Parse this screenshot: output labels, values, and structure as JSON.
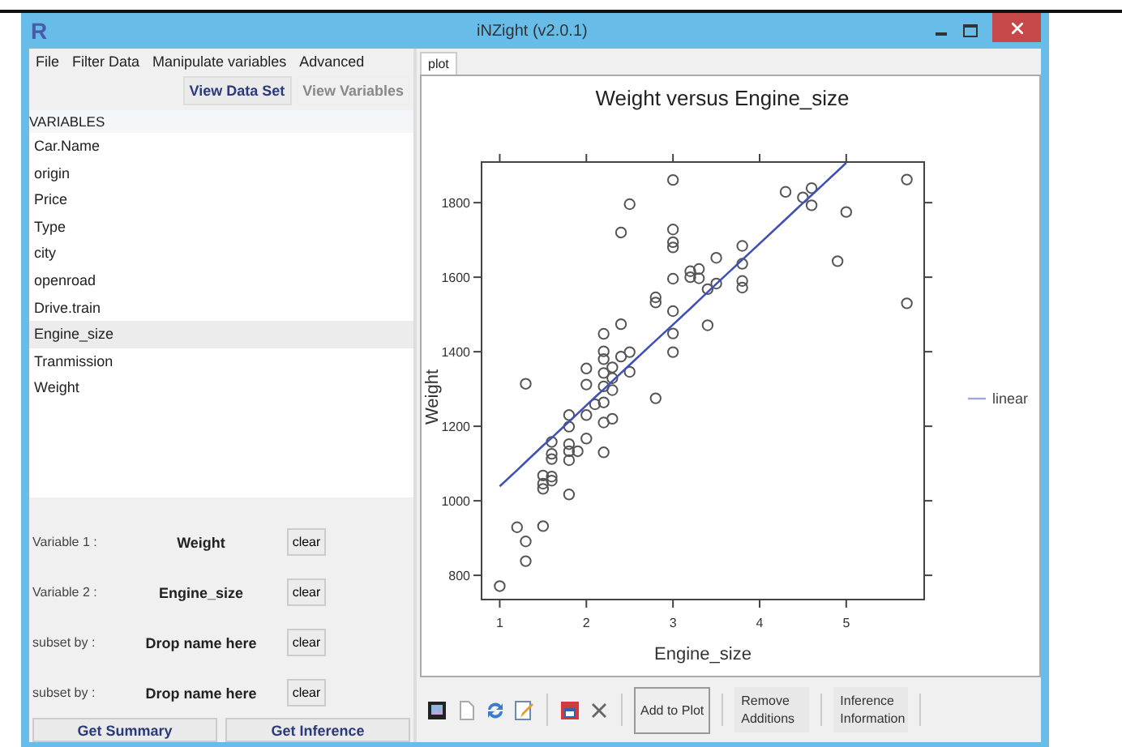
{
  "window": {
    "icon_text": "R",
    "title": "iNZight (v2.0.1)"
  },
  "menu": [
    "File",
    "Filter Data",
    "Manipulate variables",
    "Advanced"
  ],
  "data_buttons": [
    {
      "label": "View Data Set",
      "disabled": false
    },
    {
      "label": "View Variables",
      "disabled": true
    }
  ],
  "variables": {
    "header": "VARIABLES",
    "items": [
      {
        "label": "Car.Name",
        "selected": false
      },
      {
        "label": "origin",
        "selected": false
      },
      {
        "label": "Price",
        "selected": false
      },
      {
        "label": "Type",
        "selected": false
      },
      {
        "label": "city",
        "selected": false
      },
      {
        "label": "openroad",
        "selected": false
      },
      {
        "label": "Drive.train",
        "selected": false
      },
      {
        "label": "Engine_size",
        "selected": true
      },
      {
        "label": "Tranmission",
        "selected": false
      },
      {
        "label": "Weight",
        "selected": false
      }
    ]
  },
  "assignments": [
    {
      "label": "Variable 1 :",
      "value": "Weight",
      "button": "clear"
    },
    {
      "label": "Variable 2 :",
      "value": "Engine_size",
      "button": "clear"
    },
    {
      "label": "subset by :",
      "value": "Drop name here",
      "button": "clear"
    },
    {
      "label": "subset by :",
      "value": "Drop name here",
      "button": "clear"
    }
  ],
  "actions": [
    "Get Summary",
    "Get Inference"
  ],
  "tabs": [
    {
      "label": "plot",
      "selected": true
    }
  ],
  "plot": {
    "chart_data": {
      "type": "scatter",
      "title": "Weight versus Engine_size",
      "xlabel": "Engine_size",
      "ylabel": "Weight",
      "x": [
        1.0,
        1.2,
        1.3,
        1.3,
        1.3,
        1.5,
        1.5,
        1.5,
        1.5,
        1.6,
        1.6,
        1.6,
        1.6,
        1.6,
        1.8,
        1.8,
        1.8,
        1.8,
        1.8,
        1.8,
        1.9,
        2.0,
        2.0,
        2.0,
        2.0,
        2.1,
        2.2,
        2.2,
        2.2,
        2.2,
        2.2,
        2.2,
        2.2,
        2.2,
        2.3,
        2.3,
        2.3,
        2.3,
        2.4,
        2.4,
        2.4,
        2.5,
        2.5,
        2.5,
        2.8,
        2.8,
        2.8,
        3.0,
        3.0,
        3.0,
        3.0,
        3.0,
        3.0,
        3.0,
        3.0,
        3.2,
        3.2,
        3.3,
        3.3,
        3.4,
        3.4,
        3.5,
        3.5,
        3.8,
        3.8,
        3.8,
        3.8,
        4.3,
        4.5,
        4.6,
        4.6,
        4.9,
        5.0,
        5.7,
        5.7
      ],
      "series": [
        {
          "type": "scatter",
          "color": "#555555",
          "values": [
            771,
            929,
            891,
            838,
            1314,
            932,
            1068,
            1046,
            1032,
            1065,
            1054,
            1158,
            1126,
            1112,
            1017,
            1230,
            1199,
            1152,
            1133,
            1109,
            1133,
            1355,
            1312,
            1230,
            1167,
            1259,
            1448,
            1401,
            1380,
            1343,
            1307,
            1264,
            1210,
            1130,
            1358,
            1329,
            1297,
            1220,
            1720,
            1474,
            1387,
            1796,
            1399,
            1346,
            1275,
            1546,
            1532,
            1861,
            1728,
            1694,
            1680,
            1596,
            1509,
            1449,
            1399,
            1616,
            1600,
            1622,
            1597,
            1568,
            1471,
            1652,
            1583,
            1684,
            1636,
            1590,
            1572,
            1829,
            1814,
            1839,
            1793,
            1643,
            1775,
            1862,
            1530
          ]
        },
        {
          "type": "line",
          "name": "linear",
          "color": "#3f51b5",
          "values": [
            1039,
            1082,
            1104,
            1104,
            1104,
            1148,
            1148,
            1148,
            1148,
            1169,
            1169,
            1169,
            1169,
            1169,
            1213,
            1213,
            1213,
            1213,
            1213,
            1213,
            1234,
            1256,
            1256,
            1256,
            1256,
            1278,
            1299,
            1299,
            1299,
            1299,
            1299,
            1299,
            1299,
            1299,
            1321,
            1321,
            1321,
            1321,
            1343,
            1343,
            1343,
            1365,
            1365,
            1365,
            1430,
            1430,
            1430,
            1473,
            1473,
            1473,
            1473,
            1473,
            1473,
            1473,
            1473,
            1516,
            1516,
            1538,
            1538,
            1560,
            1560,
            1582,
            1582,
            1647,
            1647,
            1647,
            1647,
            1755,
            1799,
            1820,
            1820,
            1885,
            1907,
            null,
            null
          ]
        }
      ],
      "xlim": [
        0.79,
        5.9
      ],
      "ylim": [
        735,
        1909
      ],
      "xticks": [
        1,
        2,
        3,
        4,
        5
      ],
      "yticks": [
        800,
        1000,
        1200,
        1400,
        1600,
        1800
      ]
    }
  },
  "toolbar": {
    "buttons": [
      {
        "label": "Add to Plot",
        "focused": true
      },
      {
        "label": "Remove Additions",
        "focused": false
      },
      {
        "label": "Inference Information",
        "focused": false
      }
    ]
  }
}
